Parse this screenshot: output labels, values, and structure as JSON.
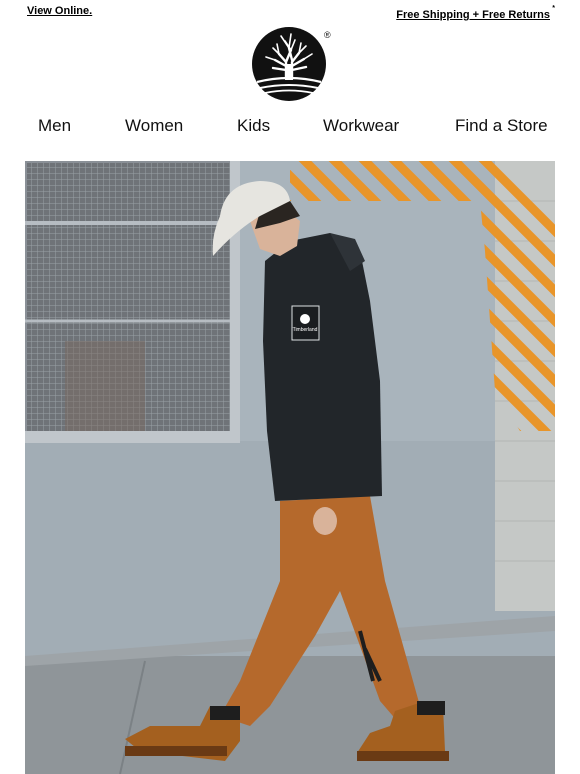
{
  "header": {
    "view_online": "View Online.",
    "shipping": "Free Shipping + Free Returns",
    "shipping_mark": "*",
    "logo_mark": "®",
    "logo_icon": "tree-logo-icon"
  },
  "nav": {
    "items": [
      "Men",
      "Women",
      "Kids",
      "Workwear",
      "Find a Store"
    ]
  },
  "hero": {
    "patch_text": "Timberland",
    "colors": {
      "wall": "#a9b4bc",
      "sidewalk": "#8f9599",
      "jacket": "#22262a",
      "pants": "#b5692c",
      "boots": "#a4601f",
      "cap": "#e6e5e0",
      "stripes": "#e8952a"
    }
  }
}
